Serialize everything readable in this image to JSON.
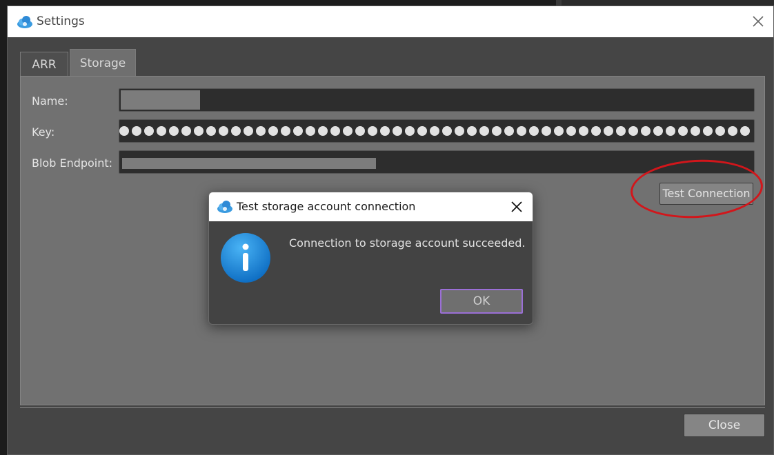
{
  "settings_window": {
    "title": "Settings",
    "tabs": [
      {
        "label": "ARR",
        "active": false
      },
      {
        "label": "Storage",
        "active": true
      }
    ],
    "fields": {
      "name_label": "Name:",
      "key_label": "Key:",
      "blob_label": "Blob Endpoint:"
    },
    "test_button_label": "Test Connection",
    "close_button_label": "Close"
  },
  "dialog": {
    "title": "Test storage account connection",
    "message": "Connection to storage account succeeded.",
    "ok_label": "OK"
  },
  "icons": {
    "app": "cloud-icon",
    "info": "info-icon",
    "close": "close-icon"
  },
  "colors": {
    "highlight": "#d2161b",
    "ok_focus_border": "#9b6fd6",
    "info_blue": "#1a86d8"
  }
}
